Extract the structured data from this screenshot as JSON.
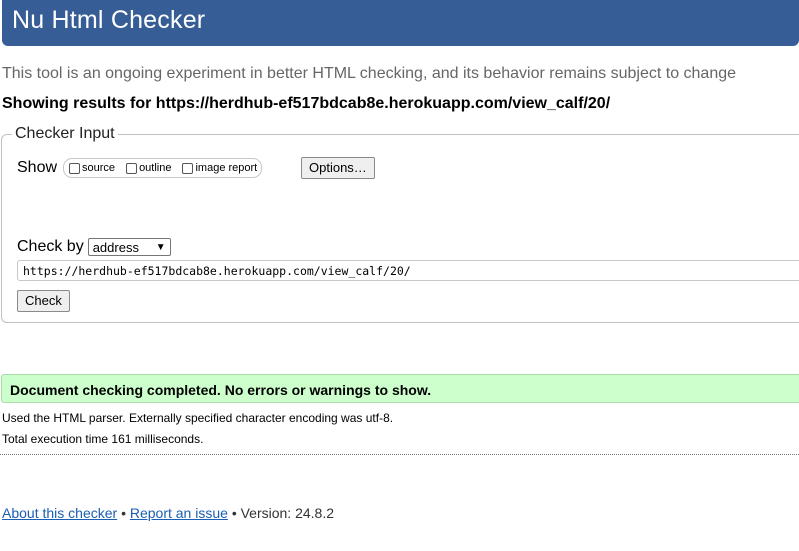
{
  "header": {
    "title": "Nu Html Checker"
  },
  "tagline": "This tool is an ongoing experiment in better HTML checking, and its behavior remains subject to change",
  "showing": "Showing results for https://herdhub-ef517bdcab8e.herokuapp.com/view_calf/20/",
  "checker_input": {
    "legend": "Checker Input",
    "show_label": "Show",
    "options": [
      {
        "label": "source",
        "checked": false
      },
      {
        "label": "outline",
        "checked": false
      },
      {
        "label": "image report",
        "checked": false
      }
    ],
    "options_button": "Options…",
    "check_by_label": "Check by",
    "check_by_value": "address",
    "url_value": "https://herdhub-ef517bdcab8e.herokuapp.com/view_calf/20/",
    "check_button": "Check"
  },
  "result": {
    "message": "Document checking completed. No errors or warnings to show.",
    "color": "#ccffcc"
  },
  "stats": {
    "parser": "Used the HTML parser. Externally specified character encoding was utf-8.",
    "time": "Total execution time 161 milliseconds."
  },
  "footer": {
    "about": "About this checker",
    "separator1": "•",
    "report": "Report an issue",
    "version": "• Version: 24.8.2"
  },
  "colors": {
    "header_bg": "#365d95",
    "link": "#1a5fb4"
  }
}
